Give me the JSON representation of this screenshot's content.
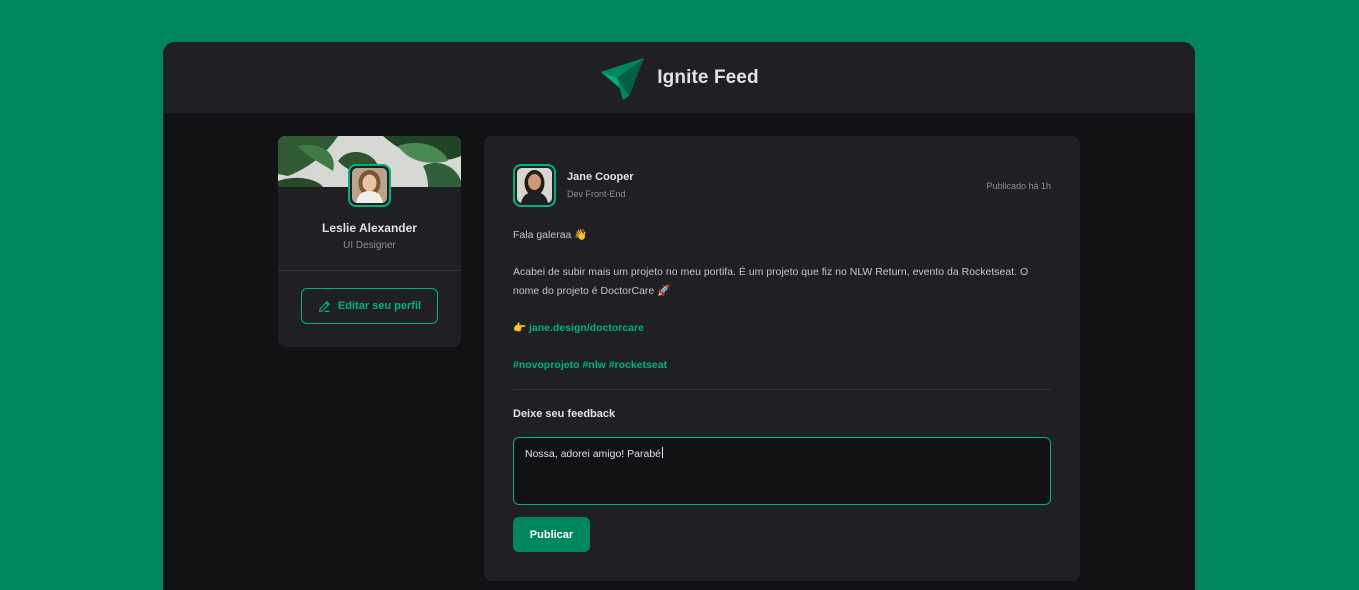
{
  "app": {
    "title": "Ignite Feed"
  },
  "sidebar": {
    "user_name": "Leslie Alexander",
    "user_role": "UI Designer",
    "edit_label": "Editar seu perfil"
  },
  "post": {
    "author_name": "Jane Cooper",
    "author_role": "Dev Front-End",
    "published": "Publicado há 1h",
    "greeting": "Fala galeraa 👋",
    "body": "Acabei de subir mais um projeto no meu portifa. É um projeto que fiz no NLW Return, evento da Rocketseat. O nome do projeto é DoctorCare 🚀",
    "link_prefix": "👉 ",
    "link": "jane.design/doctorcare",
    "hashtags": [
      "#novoprojeto",
      "#nlw",
      "#rocketseat"
    ]
  },
  "feedback": {
    "title": "Deixe seu feedback",
    "input_value": "Nossa, adorei amigo! Parabé",
    "publish_label": "Publicar"
  },
  "colors": {
    "background": "#00875F",
    "accent": "#00B37E",
    "panel": "#202024",
    "page": "#121214"
  },
  "icons": [
    "ignite-logo-icon",
    "pencil-icon"
  ]
}
